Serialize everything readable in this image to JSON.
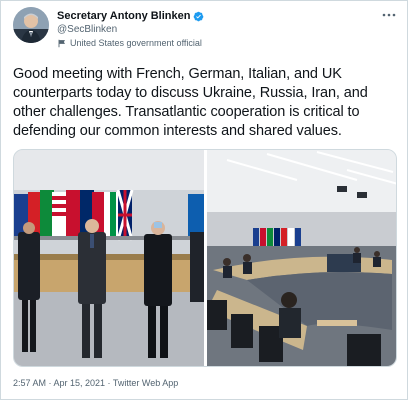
{
  "author": {
    "name": "Secretary Antony Blinken",
    "handle": "@SecBlinken",
    "label": "United States government official",
    "verified": true,
    "avatar_icon": "portrait-avatar",
    "badge_icon": "verified-badge-icon",
    "label_icon": "flag-icon"
  },
  "tweet": {
    "text": "Good meeting with French, German, Italian, and UK counterparts today to discuss Ukraine, Russia, Iran, and other challenges. Transatlantic cooperation is critical to defending our common interests and shared values."
  },
  "media": {
    "count": 2
  },
  "meta": {
    "timestamp": "2:57 AM · Apr 15, 2021 · Twitter Web App"
  },
  "colors": {
    "verified": "#1d9bf0",
    "secondary_text": "#536471",
    "border": "#cfd9de"
  }
}
